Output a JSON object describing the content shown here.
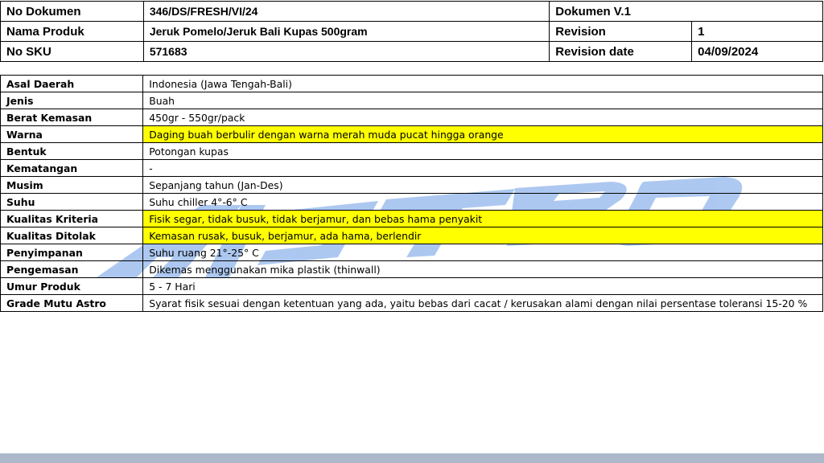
{
  "header": {
    "no_dokumen_label": "No Dokumen",
    "no_dokumen_value": "346/DS/FRESH/VI/24",
    "dokumen_version": "Dokumen V.1",
    "nama_produk_label": "Nama Produk",
    "nama_produk_value": "Jeruk Pomelo/Jeruk Bali Kupas 500gram",
    "revision_label": "Revision",
    "revision_value": "1",
    "no_sku_label": "No SKU",
    "no_sku_value": "571683",
    "revision_date_label": "Revision date",
    "revision_date_value": "04/09/2024"
  },
  "spec": [
    {
      "key": "Asal Daerah",
      "value": "Indonesia (Jawa Tengah-Bali)",
      "highlight": false
    },
    {
      "key": "Jenis",
      "value": "Buah",
      "highlight": false
    },
    {
      "key": "Berat Kemasan",
      "value": "450gr - 550gr/pack",
      "highlight": false
    },
    {
      "key": "Warna",
      "value": "Daging buah berbulir dengan warna merah muda pucat hingga orange",
      "highlight": true
    },
    {
      "key": "Bentuk",
      "value": "Potongan kupas",
      "highlight": false
    },
    {
      "key": "Kematangan",
      "value": "-",
      "highlight": false
    },
    {
      "key": "Musim",
      "value": "Sepanjang tahun (Jan-Des)",
      "highlight": false
    },
    {
      "key": "Suhu",
      "value": "Suhu chiller 4°-6° C",
      "highlight": false
    },
    {
      "key": "Kualitas Kriteria",
      "value": "Fisik segar, tidak busuk, tidak berjamur, dan bebas hama penyakit",
      "highlight": true
    },
    {
      "key": "Kualitas Ditolak",
      "value": "Kemasan rusak, busuk, berjamur, ada hama, berlendir",
      "highlight": true
    },
    {
      "key": "Penyimpanan",
      "value": "Suhu ruang 21°-25° C",
      "highlight": false
    },
    {
      "key": "Pengemasan",
      "value": "Dikemas menggunakan mika plastik (thinwall)",
      "highlight": false
    },
    {
      "key": "Umur Produk",
      "value": "5 - 7 Hari",
      "highlight": false
    },
    {
      "key": "Grade Mutu Astro",
      "value": "Syarat fisik sesuai dengan ketentuan yang ada, yaitu bebas dari cacat / kerusakan alami dengan  nilai persentase toleransi 15-20 %",
      "highlight": false
    }
  ],
  "colors": {
    "highlight": "#ffff00",
    "watermark": "#a9c6f0",
    "bottom_bar": "#adb9ca"
  },
  "watermark_text": "ASTRO"
}
